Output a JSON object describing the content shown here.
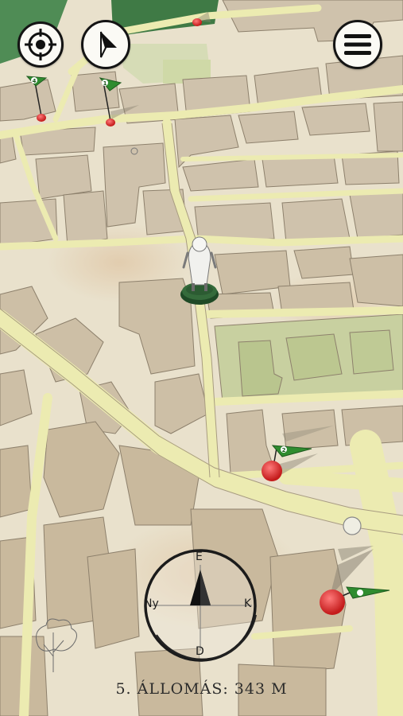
{
  "controls": {
    "recenter_icon": "crosshair-icon",
    "navigate_icon": "navigation-arrow-icon",
    "menu_icon": "hamburger-menu-icon"
  },
  "compass": {
    "north": "É",
    "west": "Ny",
    "east": "K",
    "south": "D"
  },
  "markers": [
    {
      "label": "4"
    },
    {
      "label": "1"
    },
    {
      "label": "2"
    },
    {
      "label": ""
    }
  ],
  "status": {
    "text": "5. ÁLLOMÁS: 343 M"
  },
  "colors": {
    "paper": "#e9e1cc",
    "road": "#ecebb1",
    "building": "#cfc2ac",
    "park": "#cbd3a5",
    "pin_flag": "#2f8c2f",
    "pin_head": "#d92a2a"
  }
}
